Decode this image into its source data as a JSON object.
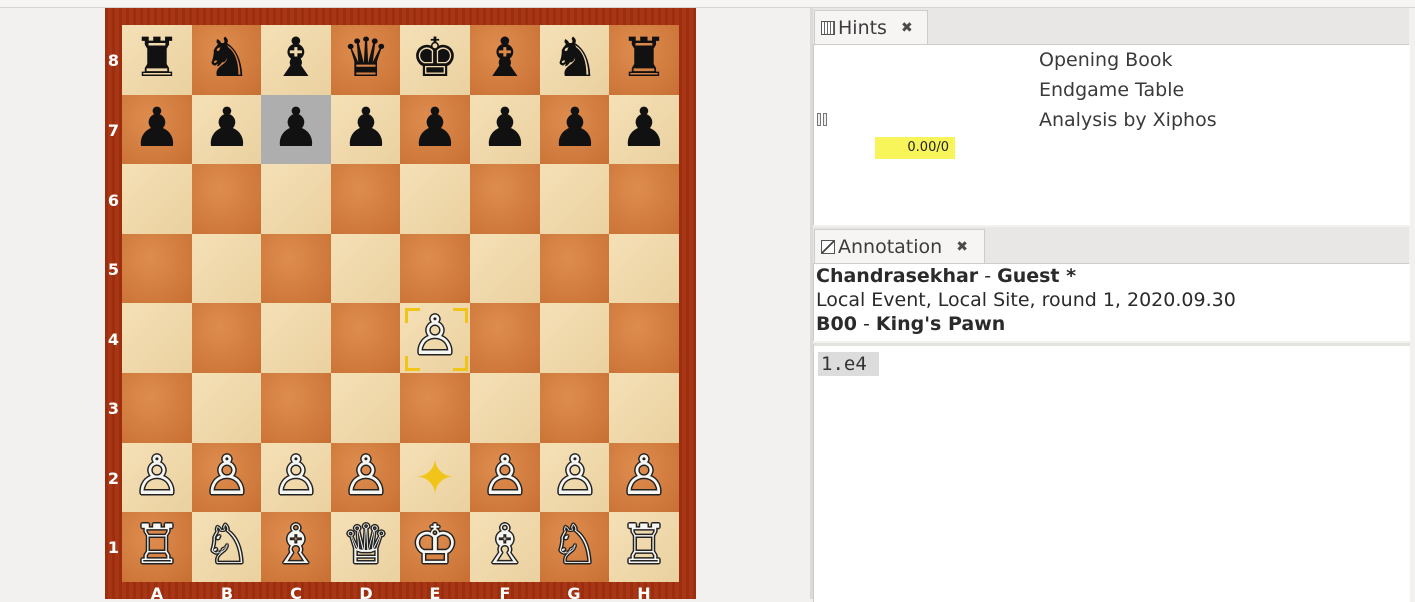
{
  "board": {
    "ranks": [
      "8",
      "7",
      "6",
      "5",
      "4",
      "3",
      "2",
      "1"
    ],
    "files": [
      "A",
      "B",
      "C",
      "D",
      "E",
      "F",
      "G",
      "H"
    ],
    "pieces": [
      [
        "♜",
        "♞",
        "♝",
        "♛",
        "♚",
        "♝",
        "♞",
        "♜"
      ],
      [
        "♟",
        "♟",
        "♟",
        "♟",
        "♟",
        "♟",
        "♟",
        "♟"
      ],
      [
        "",
        "",
        "",
        "",
        "",
        "",
        "",
        ""
      ],
      [
        "",
        "",
        "",
        "",
        "",
        "",
        "",
        ""
      ],
      [
        "",
        "",
        "",
        "",
        "♙",
        "",
        "",
        ""
      ],
      [
        "",
        "",
        "",
        "",
        "",
        "",
        "",
        ""
      ],
      [
        "♙",
        "♙",
        "♙",
        "♙",
        "",
        "♙",
        "♙",
        "♙"
      ],
      [
        "♖",
        "♘",
        "♗",
        "♕",
        "♔",
        "♗",
        "♘",
        "♖"
      ]
    ]
  },
  "hints": {
    "tab_label": "Hints",
    "tab_icon": "hints-panel-icon",
    "close": "✖",
    "lines": [
      "Opening Book",
      "Endgame Table",
      "Analysis by Xiphos"
    ],
    "score": "0.00/0"
  },
  "annotation": {
    "tab_label": "Annotation",
    "tab_icon": "annotation-panel-icon",
    "close": "✖",
    "white_player": "Chandrasekhar",
    "separator": " - ",
    "black_player": "Guest *",
    "event_line": "Local Event, Local Site, round 1, 2020.09.30",
    "eco": "B00",
    "opening": "King's Pawn",
    "moves": [
      "1.e4"
    ]
  },
  "colors": {
    "board_frame": "#a4300f",
    "light_square": "#f3d9a6",
    "dark_square": "#d3793a",
    "last_move_highlight": "#f0c419",
    "selected_square": "#aeaeae",
    "score_bar": "#f8f55a"
  }
}
